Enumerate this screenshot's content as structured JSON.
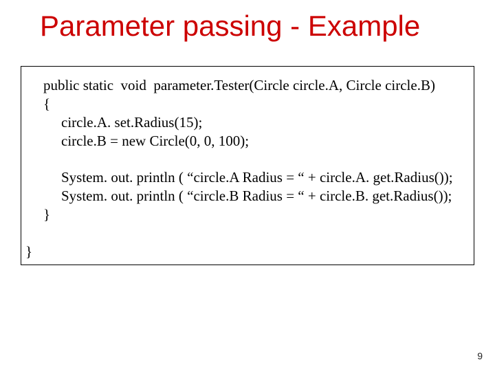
{
  "title": "Parameter passing - Example",
  "code": {
    "line_sig": "public static  void  parameter.Tester(Circle circle.A, Circle circle.B)",
    "line_open": "{",
    "line_set": "circle.A. set.Radius(15);",
    "line_new": "circle.B = new Circle(0, 0, 100);",
    "line_blank1": "",
    "line_outA": "System. out. println ( “circle.A Radius = “ + circle.A. get.Radius());",
    "line_outB": "System. out. println ( “circle.B Radius = “ + circle.B. get.Radius());",
    "line_close_inner": "}",
    "line_close_outer": "}"
  },
  "pageNumber": "9"
}
